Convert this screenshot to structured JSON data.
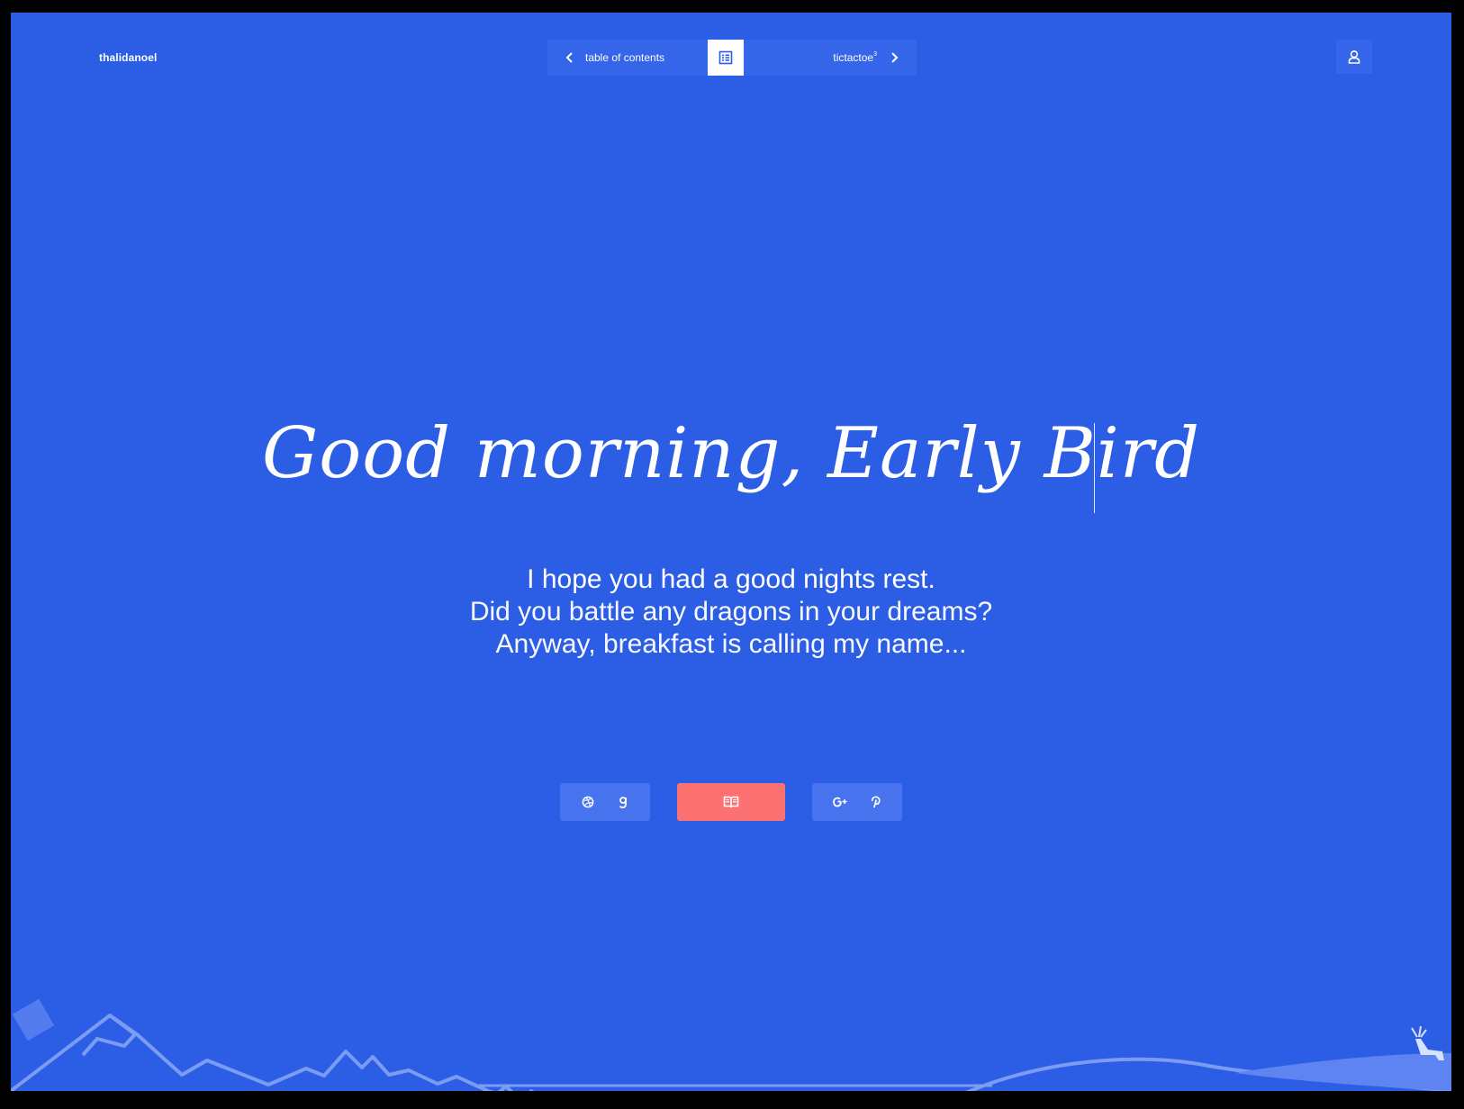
{
  "brand": {
    "name": "thalidanoel"
  },
  "nav": {
    "prev_label": "table of contents",
    "next_label": "tictactoe",
    "next_sup": "3",
    "toc_icon": "list-icon",
    "prev_icon": "chevron-left-icon",
    "next_icon": "chevron-right-icon"
  },
  "user": {
    "icon": "user-icon"
  },
  "hero": {
    "headline": "Good morning, Early Bird",
    "line1": "I hope you had a good nights rest.",
    "line2": "Did you battle any dragons in your dreams?",
    "line3": "Anyway, breakfast is calling my name..."
  },
  "actions": {
    "left_icons": [
      "dribbble-icon",
      "goodreads-icon"
    ],
    "center_icon": "book-icon",
    "right_icons": [
      "google-plus-icon",
      "pinterest-icon"
    ]
  },
  "colors": {
    "background": "#2c5de5",
    "panel": "#3565e8",
    "pill": "#4873ee",
    "accent": "#fc7272",
    "text": "#ffffff"
  }
}
